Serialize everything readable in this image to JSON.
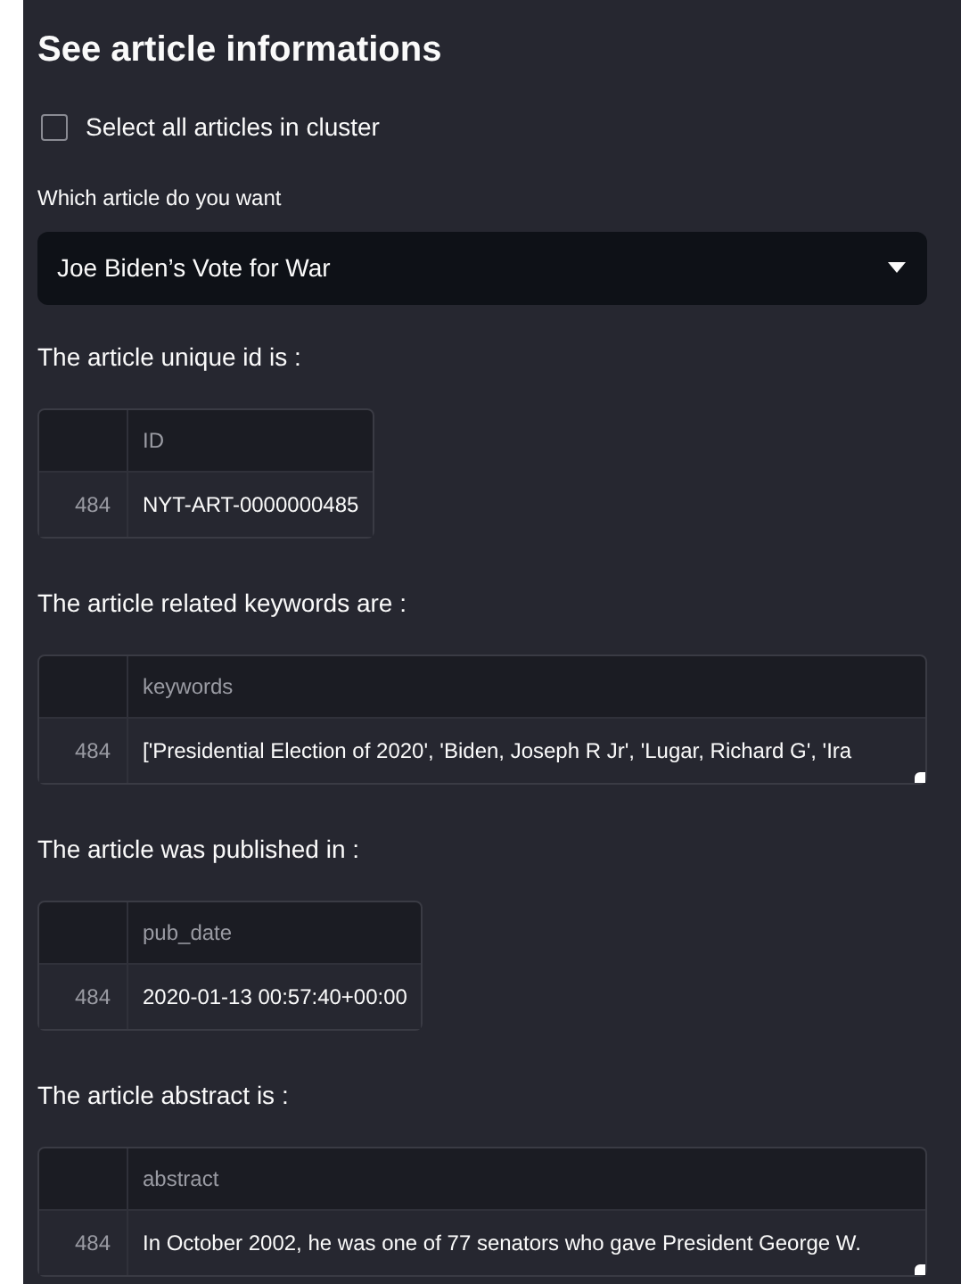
{
  "title": "See article informations",
  "select_all": {
    "label": "Select all articles in cluster",
    "checked": false
  },
  "article_select": {
    "label": "Which article do you want",
    "value": "Joe Biden’s Vote for War"
  },
  "sections": [
    {
      "label": "The article unique id is :",
      "wide": false,
      "column": "ID",
      "index": "484",
      "value": "NYT-ART-0000000485"
    },
    {
      "label": "The article related keywords are :",
      "wide": true,
      "column": "keywords",
      "index": "484",
      "value": "['Presidential Election of 2020', 'Biden, Joseph R Jr', 'Lugar, Richard G', 'Ira"
    },
    {
      "label": "The article was published in :",
      "wide": false,
      "column": "pub_date",
      "index": "484",
      "value": "2020-01-13 00:57:40+00:00"
    },
    {
      "label": "The article abstract is :",
      "wide": true,
      "column": "abstract",
      "index": "484",
      "value": "In October 2002, he was one of 77 senators who gave President George W."
    }
  ]
}
